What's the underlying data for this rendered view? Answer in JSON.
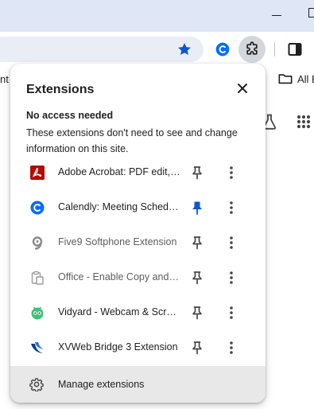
{
  "colors": {
    "titlebar": "#dfe7f6",
    "omnibox": "#e9eef6",
    "accent_blue": "#0b57d0",
    "manage_row": "#e8e8e8",
    "pdf_red": "#b30b00",
    "calendly_blue": "#006bff",
    "vidyard_green": "#3bc47a",
    "xvweb_navy": "#0a3d91"
  },
  "bookmarks_bar": {
    "left_fragment": "nt",
    "all_bookmarks_label": "All B"
  },
  "popup": {
    "title": "Extensions",
    "section_title": "No access needed",
    "section_desc": "These extensions don't need to see and change information on this site.",
    "extensions": [
      {
        "name": "Adobe Acrobat: PDF edit, c...",
        "icon": "adobe-acrobat-icon",
        "pinned": false,
        "dim": false
      },
      {
        "name": "Calendly: Meeting Schedul...",
        "icon": "calendly-icon",
        "pinned": true,
        "dim": false
      },
      {
        "name": "Five9 Softphone Extension",
        "icon": "five9-icon",
        "pinned": false,
        "dim": true
      },
      {
        "name": "Office - Enable Copy and P...",
        "icon": "office-clipboard-icon",
        "pinned": false,
        "dim": true
      },
      {
        "name": "Vidyard - Webcam & Scree...",
        "icon": "vidyard-icon",
        "pinned": false,
        "dim": false
      },
      {
        "name": "XVWeb Bridge 3 Extension",
        "icon": "xvweb-icon",
        "pinned": false,
        "dim": false
      }
    ],
    "manage_label": "Manage extensions"
  }
}
